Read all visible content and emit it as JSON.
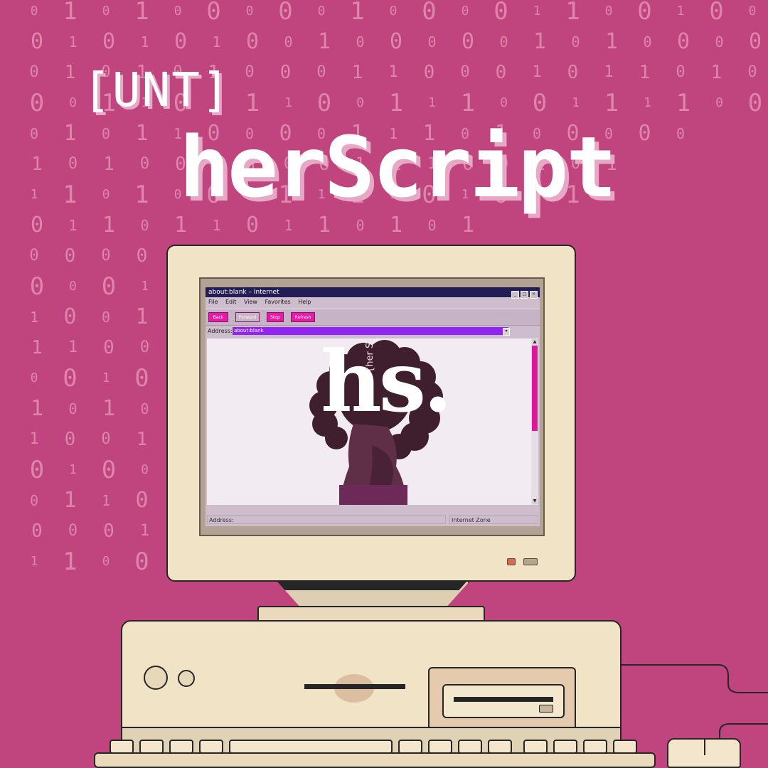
{
  "background": {
    "color": "#c0457f",
    "digit_color": "#dd85ab",
    "digits_rows": [
      "0 1 0 1 0 0 0 0 0 1 0 0 0 0 1 1 0 0 1 0 0 1 0",
      "0 1 0 1 0 1 0 0 1 0 0 0 0 0 1 0 1 0 0 0 0 0 1",
      "0 1 0 1 0 1 0 0 0 1 1 0 0 0 1 0 1 1 0 1 0",
      "0 0 1 1 0 1 1 1 0 0 1 1 1 0 0 1 1 1 1 0 0",
      "0 1 0 1 1 0 0 0 0 1 1 1 0 1 0 0 0 0 0",
      "1 0 1 0 0 0 1 0 0 1 1 1 0 0 1 0 1",
      "1 1 0 1 0 0 0 1 1 1 1 0 1 0 1 1",
      "0 1 1 0 1 1 0 1 1 0 1 0 1",
      "0 0 0 0 0 1 0 0 1 0 1 0 0",
      "0 0 0 1 1 1 1 0 0",
      "1 0 0 1 1 0 1 0 1",
      "1 1 0 0 0 0 0 0 0",
      "0 0 1 0 1 0 0 1 0 1",
      "1 0 1 0 0 1 0 1 1",
      "1 0 0 1 1 0 1 1 1",
      "0 1 0 0 1 0 0 0 1",
      "0 1 1 0 1 0 0",
      "0 0 0 1 0 0",
      "1 1 0 0 0 1 0"
    ]
  },
  "brand": {
    "tag": "[UNT]",
    "name": "herScript"
  },
  "browser": {
    "title": "about:blank – Internet",
    "window_buttons": [
      "_",
      "□",
      "×"
    ],
    "menu": [
      "File",
      "Edit",
      "View",
      "Favorites",
      "Help"
    ],
    "toolbar": [
      {
        "label": "Back",
        "color": "#ea1aa8"
      },
      {
        "label": "Forward",
        "color": "#c9b3c4"
      },
      {
        "label": "Stop",
        "color": "#ea1aa8"
      },
      {
        "label": "Refresh",
        "color": "#ea1aa8"
      }
    ],
    "address_label": "Address:",
    "address_value": "about:blank",
    "status_left": "Address:",
    "status_right": "Internet Zone",
    "accent_color": "#8f25ee",
    "scrollbar_color": "#e0179a"
  },
  "logo": {
    "mark": "hs.",
    "subtitle": "{her Script}"
  },
  "icons": {
    "scroll_up": "▲",
    "scroll_down": "▼",
    "dropdown": "▾"
  }
}
